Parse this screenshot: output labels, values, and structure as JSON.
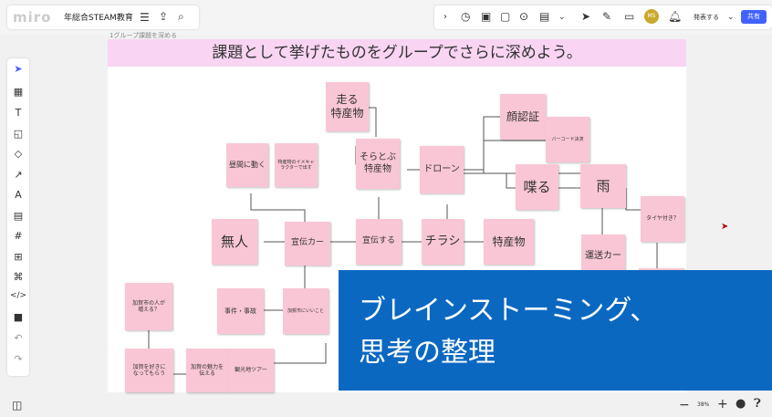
{
  "app": {
    "logo": "miro",
    "board_title": "年総合STEAM教育",
    "menu_icon": "menu-icon",
    "share_icon": "export-icon",
    "search_icon": "search-icon"
  },
  "toolbar_right": {
    "present_label": "発表する",
    "share_label": "共有",
    "avatar_label": "MS",
    "zoom": "38%"
  },
  "frame": {
    "label": "1グループ課題を深める",
    "title": "課題として挙げたものをグループでさらに深めよう。"
  },
  "notes": [
    {
      "id": "n1",
      "text": "走る\n特産物"
    },
    {
      "id": "n2",
      "text": "顔認証"
    },
    {
      "id": "n3",
      "text": "バーコード決済"
    },
    {
      "id": "n4",
      "text": "昼間に動く"
    },
    {
      "id": "n5",
      "text": "特産物のイメキャラクターで出す"
    },
    {
      "id": "n6",
      "text": "そらとぶ\n特産物"
    },
    {
      "id": "n7",
      "text": "ドローン"
    },
    {
      "id": "n8",
      "text": "喋る"
    },
    {
      "id": "n9",
      "text": "雨"
    },
    {
      "id": "n10",
      "text": "タイヤ付き？"
    },
    {
      "id": "n11",
      "text": "無人"
    },
    {
      "id": "n12",
      "text": "宣伝カー"
    },
    {
      "id": "n13",
      "text": "宣伝する"
    },
    {
      "id": "n14",
      "text": "チラシ"
    },
    {
      "id": "n15",
      "text": "特産物"
    },
    {
      "id": "n16",
      "text": "運送カー"
    },
    {
      "id": "n17",
      "text": "加賀市の人が\n増える？"
    },
    {
      "id": "n18",
      "text": "事件・事故"
    },
    {
      "id": "n19",
      "text": "加賀市にいいこと"
    },
    {
      "id": "n20",
      "text": "加賀を好きに\nなってもらう"
    },
    {
      "id": "n21",
      "text": "加賀の魅力を\n伝える"
    },
    {
      "id": "n22",
      "text": "観光地ツアー"
    }
  ],
  "overlay": {
    "caption": "ブレインストーミング、\n思考の整理"
  },
  "colors": {
    "note": "#f9c6d5",
    "header": "#f9d4f3",
    "overlay": "#0b68c1",
    "accent": "#4262ff"
  }
}
